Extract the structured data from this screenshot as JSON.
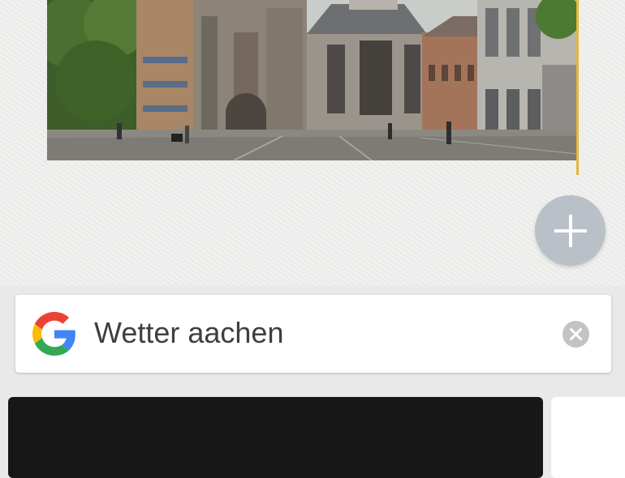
{
  "search": {
    "query": "Wetter aachen"
  },
  "icons": {
    "logo": "google-g-icon",
    "add": "plus-icon",
    "clear": "close-icon"
  },
  "colors": {
    "accent": "#e2b93b",
    "fab": "#b9c0c8",
    "google_blue": "#4285F4",
    "google_red": "#EA4335",
    "google_yellow": "#FBBC05",
    "google_green": "#34A853"
  }
}
